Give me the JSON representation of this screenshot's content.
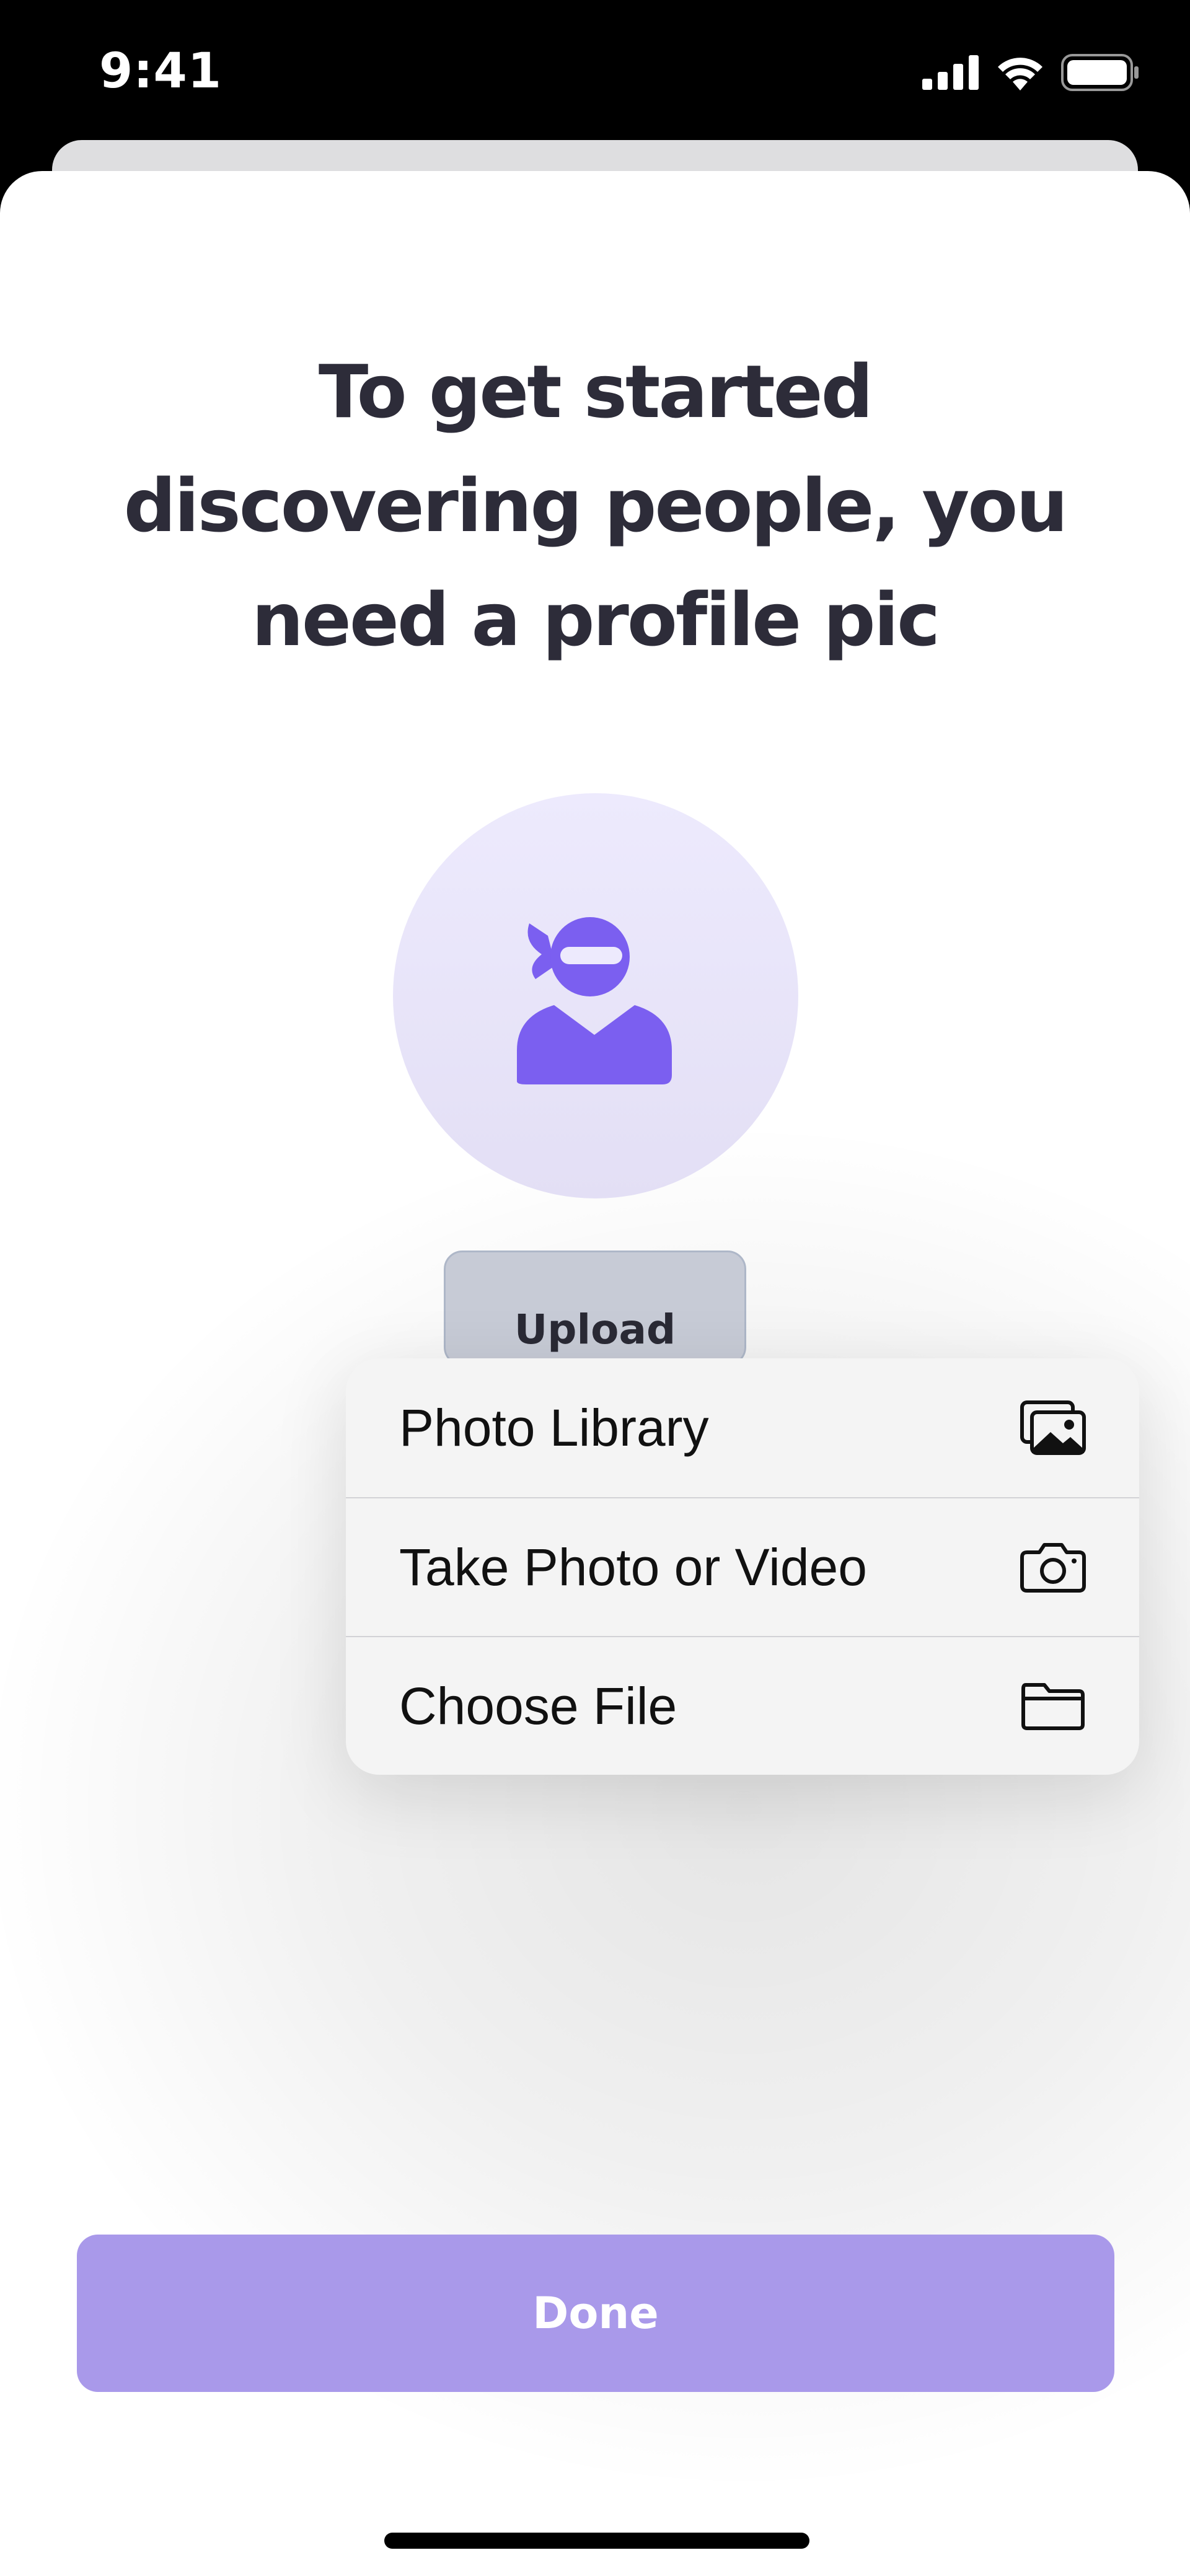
{
  "status_bar": {
    "time": "9:41"
  },
  "page": {
    "heading": "To get started discovering people, you need a profile pic",
    "upload_label": "Upload",
    "done_label": "Done"
  },
  "menu": {
    "items": [
      {
        "label": "Photo Library",
        "icon": "photo-library-icon"
      },
      {
        "label": "Take Photo or Video",
        "icon": "camera-icon"
      },
      {
        "label": "Choose File",
        "icon": "folder-icon"
      }
    ]
  },
  "colors": {
    "heading": "#2d2c39",
    "accent_purple": "#7b5ff0",
    "avatar_bg": "#edeafd",
    "done_button": "#a999ea",
    "upload_button": "#c7cbd6"
  }
}
